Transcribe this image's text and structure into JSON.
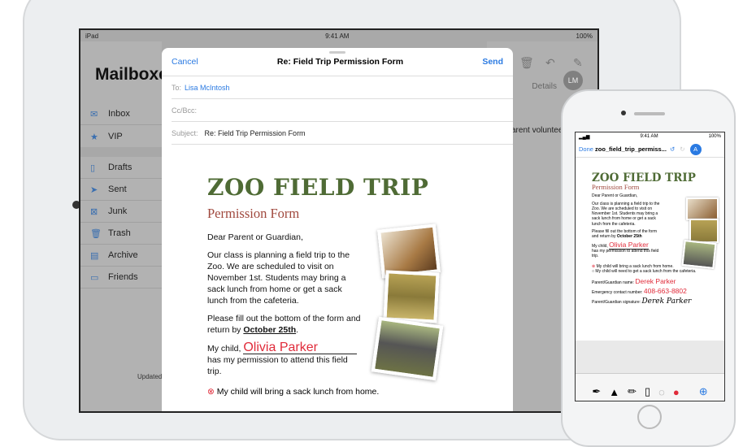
{
  "ipad": {
    "status": {
      "carrier": "iPad",
      "time": "9:41 AM",
      "battery": "100%"
    },
    "sidebar": {
      "title": "Mailboxes",
      "items": [
        {
          "label": "Inbox",
          "icon": "inbox-icon"
        },
        {
          "label": "VIP",
          "icon": "star-icon"
        },
        {
          "label": "Drafts",
          "icon": "doc-icon"
        },
        {
          "label": "Sent",
          "icon": "paperplane-icon"
        },
        {
          "label": "Junk",
          "icon": "junk-icon"
        },
        {
          "label": "Trash",
          "icon": "trash-icon"
        },
        {
          "label": "Archive",
          "icon": "archive-icon"
        },
        {
          "label": "Friends",
          "icon": "folder-icon"
        }
      ],
      "updated": "Updated"
    },
    "message": {
      "details": "Details",
      "avatar": "LM",
      "snippet": "arent voluntee"
    },
    "compose": {
      "cancel": "Cancel",
      "title": "Re: Field Trip Permission Form",
      "send": "Send",
      "to_label": "To:",
      "to": "Lisa McIntosh",
      "cc_label": "Cc/Bcc:",
      "subject_label": "Subject:",
      "subject": "Re: Field Trip Permission Form"
    },
    "form": {
      "title": "ZOO FIELD TRIP",
      "subtitle": "Permission Form",
      "greeting": "Dear Parent or Guardian,",
      "p1": "Our class is planning a field trip to the Zoo. We are scheduled to visit on November 1st. Students may bring a sack lunch from home or get a sack lunch from the cafeteria.",
      "p2a": "Please fill out the bottom of the form and return by ",
      "p2b": "October 25th",
      "p3a": "My child,",
      "child": "Olivia Parker",
      "p3b": "has my permission to attend this field trip.",
      "opt1": "My child will bring a sack lunch from home.",
      "opt2": "My child will need to get a sack lunch from the cafeteria.",
      "parent_label": "Parent/Guardian name:",
      "parent": "Derek Parker",
      "phone_label": "Emergency contact number:",
      "phone": "408-663-8802",
      "sig_label": "Parent/Guardian signature:",
      "signature": "Derek Parker"
    }
  },
  "iphone": {
    "status": {
      "time": "9:41 AM",
      "battery": "100%"
    },
    "done": "Done",
    "filename": "zoo_field_trip_permiss..."
  },
  "colors": {
    "accent": "#2a7ae2",
    "title_green": "#4f6b35",
    "subtitle_red": "#a0493e",
    "ink_red": "#e02b3a"
  }
}
